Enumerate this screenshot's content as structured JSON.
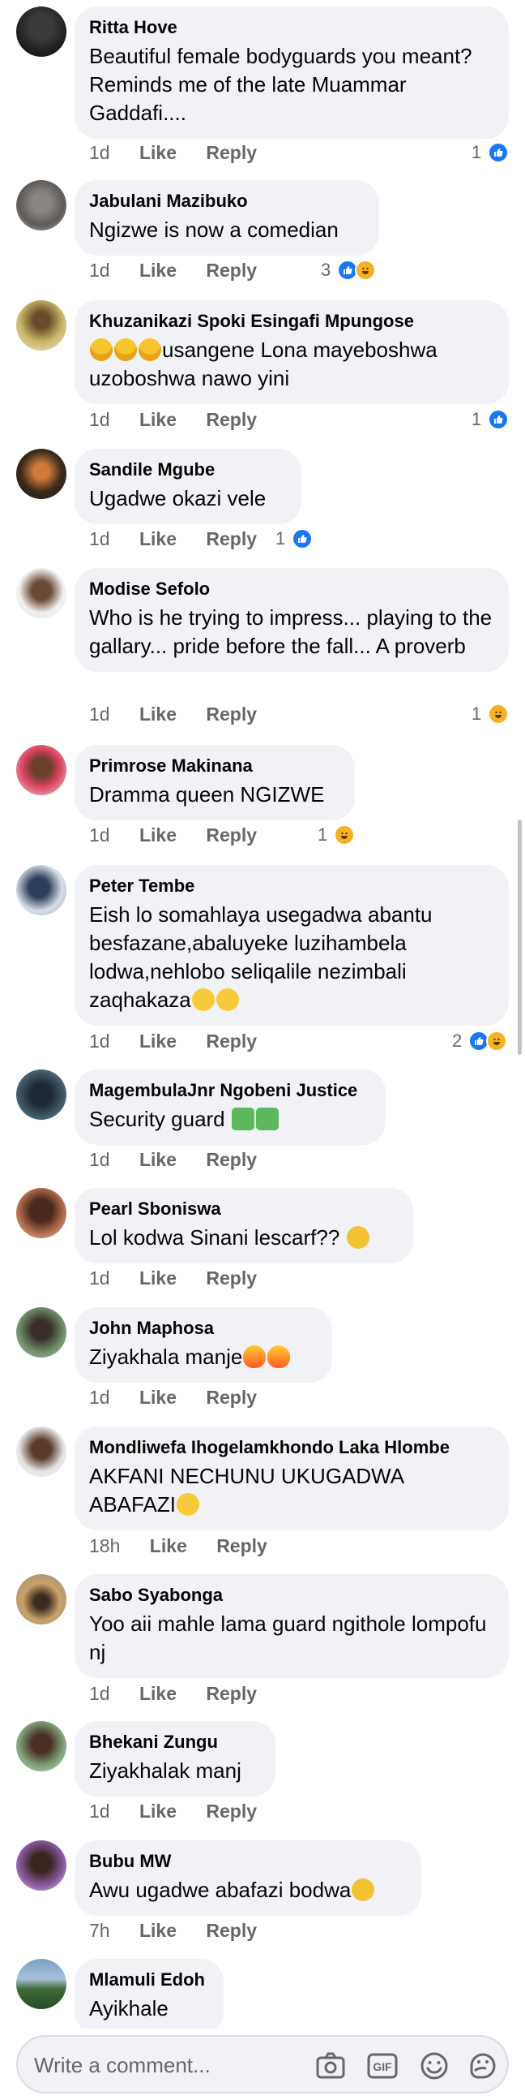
{
  "comments": [
    {
      "name": "Ritta Hove",
      "text": "Beautiful female bodyguards you meant? Reminds me of the late Muammar Gaddafi....",
      "time": "1d",
      "like": "Like",
      "reply": "Reply",
      "reactions": {
        "count": "1",
        "types": [
          "like"
        ]
      }
    },
    {
      "name": "Jabulani Mazibuko",
      "text": "Ngizwe is now a comedian",
      "time": "1d",
      "like": "Like",
      "reply": "Reply",
      "reactions": {
        "count": "3",
        "types": [
          "like",
          "haha"
        ]
      }
    },
    {
      "name": "Khuzanikazi Spoki Esingafi Mpungose",
      "text_suffix": "usangene Lona  mayeboshwa uzoboshwa nawo yini",
      "time": "1d",
      "like": "Like",
      "reply": "Reply",
      "reactions": {
        "count": "1",
        "types": [
          "like"
        ]
      }
    },
    {
      "name": "Sandile Mgube",
      "text": "Ugadwe okazi vele",
      "time": "1d",
      "like": "Like",
      "reply": "Reply",
      "reactions": {
        "count": "1",
        "types": [
          "like"
        ]
      }
    },
    {
      "name": "Modise Sefolo",
      "text": "Who is he trying to impress... playing to the gallary... pride before the fall... A proverb",
      "time": "1d",
      "like": "Like",
      "reply": "Reply",
      "reactions": {
        "count": "1",
        "types": [
          "haha"
        ]
      }
    },
    {
      "name": "Primrose Makinana",
      "text": "Dramma queen NGIZWE",
      "time": "1d",
      "like": "Like",
      "reply": "Reply",
      "reactions": {
        "count": "1",
        "types": [
          "haha"
        ]
      }
    },
    {
      "name": "Peter Tembe",
      "text": "Eish lo somahlaya usegadwa abantu besfazane,abaluyeke luzihambela lodwa,nehlobo seliqalile nezimbali zaqhakaza",
      "time": "1d",
      "like": "Like",
      "reply": "Reply",
      "reactions": {
        "count": "2",
        "types": [
          "like",
          "haha"
        ]
      }
    },
    {
      "name": "MagembulaJnr Ngobeni Justice",
      "text": "Security guard ",
      "time": "1d",
      "like": "Like",
      "reply": "Reply"
    },
    {
      "name": "Pearl Sboniswa",
      "text": "Lol kodwa Sinani lescarf?? ",
      "time": "1d",
      "like": "Like",
      "reply": "Reply"
    },
    {
      "name": "John Maphosa",
      "text": "Ziyakhala manje",
      "time": "1d",
      "like": "Like",
      "reply": "Reply"
    },
    {
      "name": "Mondliwefa Ihogelamkhondo Laka Hlombe",
      "text": "AKFANI NECHUNU UKUGADWA ABAFAZI",
      "time": "18h",
      "like": "Like",
      "reply": "Reply"
    },
    {
      "name": "Sabo Syabonga",
      "text": "Yoo aii mahle lama guard ngithole lompofu nj",
      "time": "1d",
      "like": "Like",
      "reply": "Reply"
    },
    {
      "name": "Bhekani Zungu",
      "text": "Ziyakhalak manj",
      "time": "1d",
      "like": "Like",
      "reply": "Reply"
    },
    {
      "name": "Bubu MW",
      "text": "Awu ugadwe abafazi bodwa",
      "time": "7h",
      "like": "Like",
      "reply": "Reply"
    },
    {
      "name": "Mlamuli Edoh",
      "text": "Ayikhale"
    }
  ],
  "composer": {
    "placeholder": "Write a comment...",
    "icons": [
      "camera-icon",
      "gif-icon",
      "emoji-icon",
      "sticker-icon"
    ]
  },
  "colors": {
    "like": "#1877f2",
    "haha": "#f7b125",
    "bubble": "#f0f2f5",
    "meta": "#65676b"
  }
}
